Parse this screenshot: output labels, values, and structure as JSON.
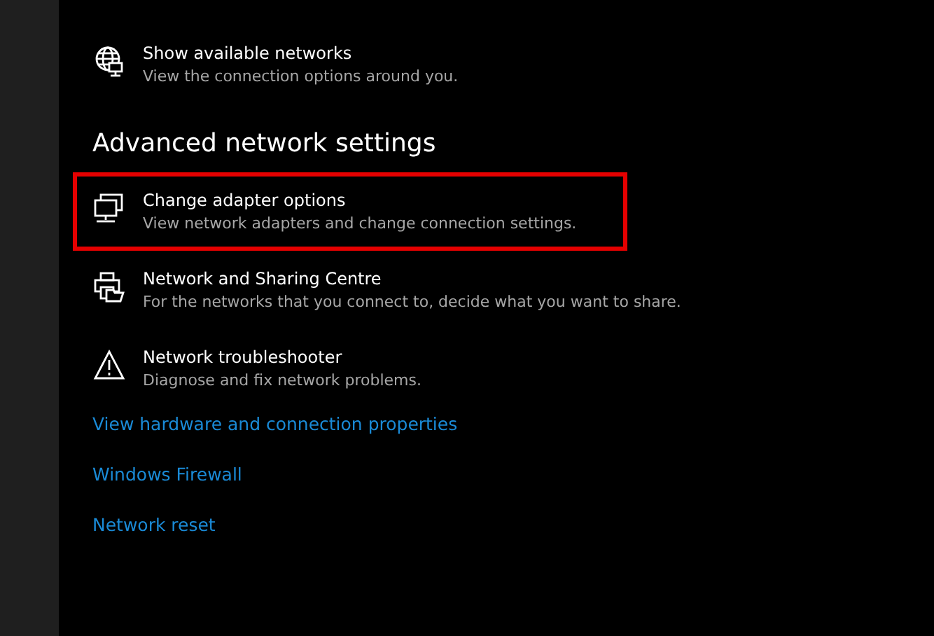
{
  "top_item": {
    "kind": "globe",
    "title": "Show available networks",
    "description": "View the connection options around you.",
    "highlighted": false
  },
  "section_heading": "Advanced network settings",
  "items": [
    {
      "kind": "monitors",
      "title": "Change adapter options",
      "description": "View network adapters and change connection settings.",
      "highlighted": true
    },
    {
      "kind": "printer",
      "title": "Network and Sharing Centre",
      "description": "For the networks that you connect to, decide what you want to share.",
      "highlighted": false
    },
    {
      "kind": "warning",
      "title": "Network troubleshooter",
      "description": "Diagnose and fix network problems.",
      "highlighted": false
    }
  ],
  "links": [
    "View hardware and connection properties",
    "Windows Firewall",
    "Network reset"
  ]
}
